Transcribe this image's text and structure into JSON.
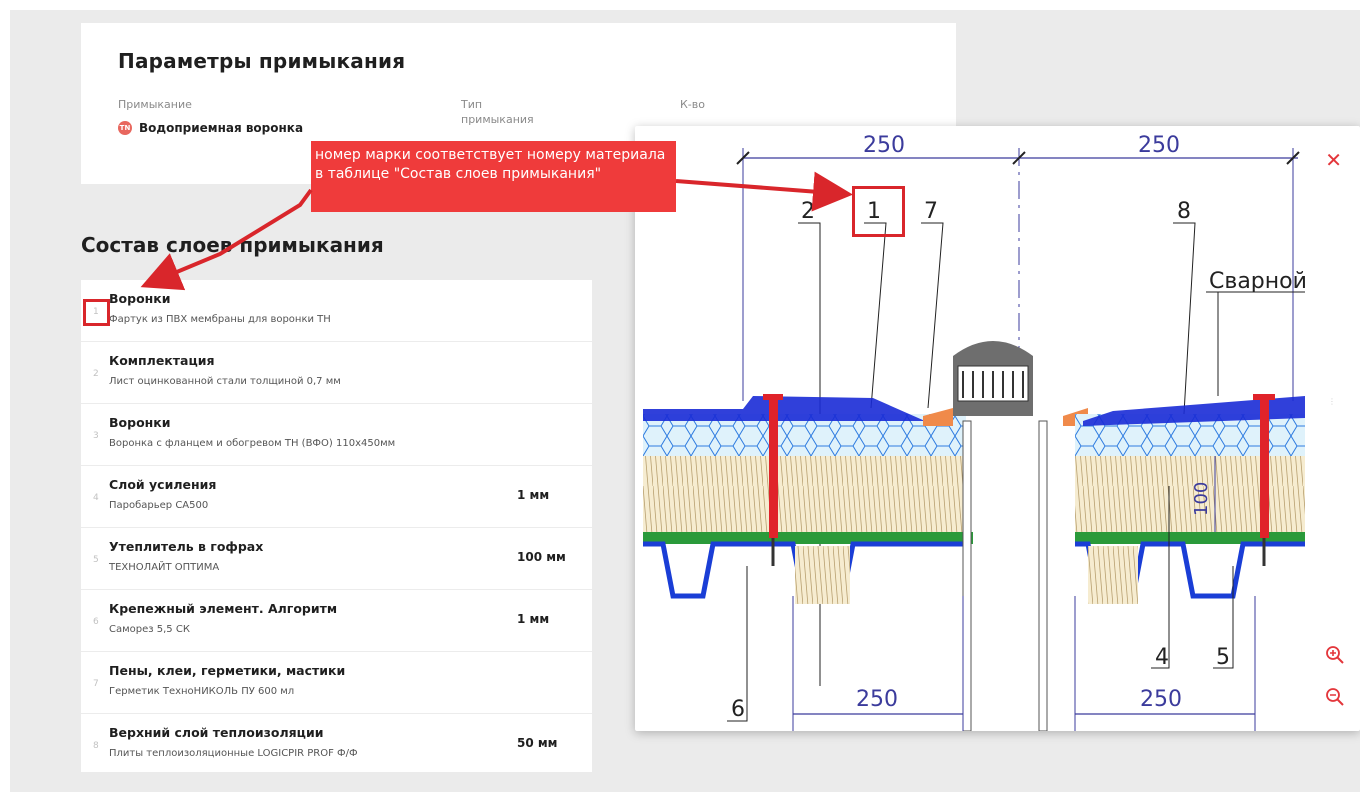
{
  "params": {
    "title": "Параметры примыкания",
    "columns": [
      {
        "label": "Примыкание",
        "value": "Водоприемная воронка",
        "icon": "tn-logo-icon"
      },
      {
        "label": "Тип\nпримыкания",
        "value": ""
      },
      {
        "label": "К-во",
        "value": ""
      }
    ],
    "tn_icon_text": "TN"
  },
  "callout": {
    "text": "номер марки соответствует номеру материала в таблице \"Состав слоев примыкания\"",
    "color": "#ef3b3b"
  },
  "layers": {
    "title": "Состав слоев примыкания",
    "items": [
      {
        "num": "1",
        "title": "Воронки",
        "subtitle": "Фартук из ПВХ мембраны для воронки ТН",
        "value": ""
      },
      {
        "num": "2",
        "title": "Комплектация",
        "subtitle": "Лист оцинкованной стали толщиной 0,7 мм",
        "value": ""
      },
      {
        "num": "3",
        "title": "Воронки",
        "subtitle": "Воронка с фланцем и обогревом ТН (ВФО) 110х450мм",
        "value": ""
      },
      {
        "num": "4",
        "title": "Слой усиления",
        "subtitle": "Паробарьер СА500",
        "value": "1 мм"
      },
      {
        "num": "5",
        "title": "Утеплитель в гофрах",
        "subtitle": "ТЕХНОЛАЙТ ОПТИМА",
        "value": "100 мм"
      },
      {
        "num": "6",
        "title": "Крепежный элемент. Алгоритм",
        "subtitle": "Саморез 5,5 СК",
        "value": "1 мм"
      },
      {
        "num": "7",
        "title": "Пены, клеи, герметики, мастики",
        "subtitle": "Герметик ТехноНИКОЛЬ ПУ 600 мл",
        "value": ""
      },
      {
        "num": "8",
        "title": "Верхний слой теплоизоляции",
        "subtitle": "Плиты теплоизоляционные LOGICPIR PROF Ф/Ф",
        "value": "50 мм"
      }
    ]
  },
  "drawing": {
    "dims_top": [
      "250",
      "250"
    ],
    "dims_bottom": [
      "250",
      "250"
    ],
    "dim_vertical": "100",
    "marks": [
      "2",
      "1",
      "7",
      "8",
      "6",
      "4",
      "5"
    ],
    "text_label": "Сварной",
    "close_label": "✕"
  },
  "colors": {
    "accent": "#e3363b",
    "dimension": "#3b3b9c",
    "membrane": "#1a2bd6",
    "insulation": "#d8f0fa",
    "mineral_wool": "#f2e6c4",
    "steel": "#1a3ed6",
    "fastener": "#e0232a"
  }
}
